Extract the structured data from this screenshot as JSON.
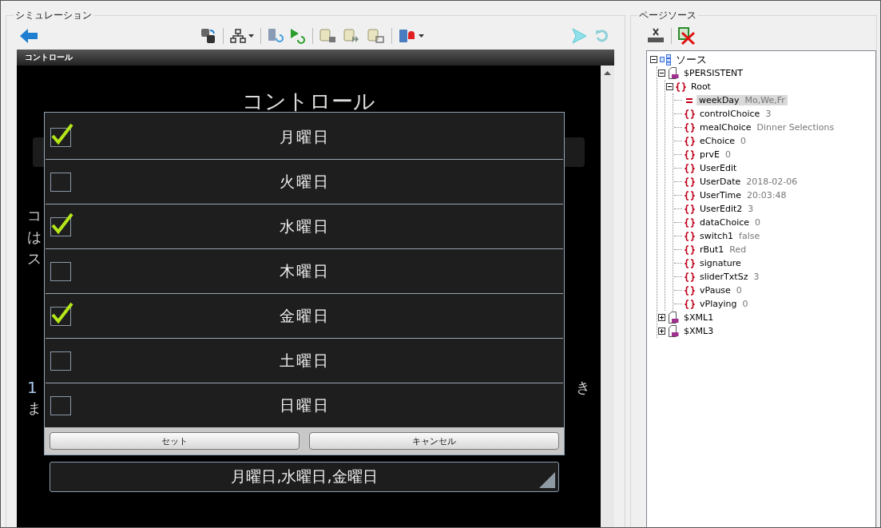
{
  "simulation": {
    "title": "シミュレーション",
    "device": {
      "header": "コントロール",
      "screen_title": "コントロール",
      "upper_fragments": [
        "コ",
        "は",
        "ス"
      ],
      "lower_left_fragments": [
        "1",
        "ま"
      ],
      "lower_right_fragments": [
        "き"
      ],
      "dialog": {
        "options": [
          {
            "label": "月曜日",
            "checked": true
          },
          {
            "label": "火曜日",
            "checked": false
          },
          {
            "label": "水曜日",
            "checked": true
          },
          {
            "label": "木曜日",
            "checked": false
          },
          {
            "label": "金曜日",
            "checked": true
          },
          {
            "label": "土曜日",
            "checked": false
          },
          {
            "label": "日曜日",
            "checked": false
          }
        ],
        "buttons": [
          "セット",
          "キャンセル"
        ]
      },
      "selection_field": {
        "value": "月曜日,水曜日,金曜日"
      }
    }
  },
  "page_source": {
    "title": "ページソース",
    "tree": [
      {
        "label": "ソース",
        "kind": "root",
        "expanded": true,
        "children": [
          {
            "label": "$PERSISTENT",
            "kind": "document",
            "expanded": true,
            "children": [
              {
                "label": "Root",
                "kind": "object",
                "expanded": true,
                "children": [
                  {
                    "label": "weekDay",
                    "value": "Mo,We,Fr",
                    "kind": "value",
                    "selected": true
                  },
                  {
                    "label": "controlChoice",
                    "value": "3",
                    "kind": "object",
                    "selected": false
                  },
                  {
                    "label": "mealChoice",
                    "value": "Dinner Selections",
                    "kind": "object",
                    "selected": false
                  },
                  {
                    "label": "eChoice",
                    "value": "0",
                    "kind": "object",
                    "selected": false
                  },
                  {
                    "label": "prvE",
                    "value": "0",
                    "kind": "object",
                    "selected": false
                  },
                  {
                    "label": "UserEdit",
                    "kind": "object",
                    "selected": false
                  },
                  {
                    "label": "UserDate",
                    "value": "2018-02-06",
                    "kind": "object",
                    "selected": false
                  },
                  {
                    "label": "UserTime",
                    "value": "20:03:48",
                    "kind": "object",
                    "selected": false
                  },
                  {
                    "label": "UserEdit2",
                    "value": "3",
                    "kind": "object",
                    "selected": false
                  },
                  {
                    "label": "dataChoice",
                    "value": "0",
                    "kind": "object",
                    "selected": false
                  },
                  {
                    "label": "switch1",
                    "value": "false",
                    "kind": "object",
                    "selected": false
                  },
                  {
                    "label": "rBut1",
                    "value": "Red",
                    "kind": "object",
                    "selected": false
                  },
                  {
                    "label": "signature",
                    "kind": "object",
                    "selected": false
                  },
                  {
                    "label": "sliderTxtSz",
                    "value": "3",
                    "kind": "object",
                    "selected": false
                  },
                  {
                    "label": "vPause",
                    "value": "0",
                    "kind": "object",
                    "selected": false
                  },
                  {
                    "label": "vPlaying",
                    "value": "0",
                    "kind": "object",
                    "selected": false
                  }
                ]
              }
            ]
          },
          {
            "label": "$XML1",
            "kind": "document",
            "expanded": false
          },
          {
            "label": "$XML3",
            "kind": "document",
            "expanded": false
          }
        ]
      }
    ]
  }
}
